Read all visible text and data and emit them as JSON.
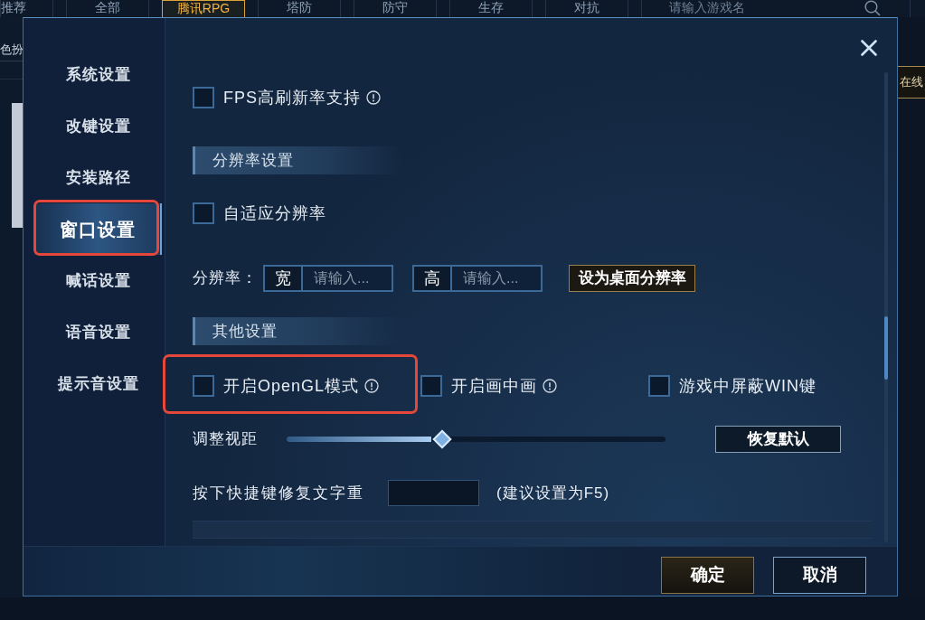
{
  "category_tabs": [
    {
      "label": "推荐",
      "selected": false
    },
    {
      "label": "全部",
      "selected": false
    },
    {
      "label": "腾讯RPG",
      "selected": true
    },
    {
      "label": "塔防",
      "selected": false
    },
    {
      "label": "防守",
      "selected": false
    },
    {
      "label": "生存",
      "selected": false
    },
    {
      "label": "对抗",
      "selected": false
    }
  ],
  "game_search": {
    "placeholder": "请输入游戏名"
  },
  "side_category": "色扮",
  "online_button": "在线",
  "settings_dialog": {
    "sidebar": [
      {
        "label": "系统设置",
        "selected": false,
        "highlighted": false
      },
      {
        "label": "改键设置",
        "selected": false,
        "highlighted": false
      },
      {
        "label": "安装路径",
        "selected": false,
        "highlighted": false
      },
      {
        "label": "窗口设置",
        "selected": true,
        "highlighted": true
      },
      {
        "label": "喊话设置",
        "selected": false,
        "highlighted": false
      },
      {
        "label": "语音设置",
        "selected": false,
        "highlighted": false
      },
      {
        "label": "提示音设置",
        "selected": false,
        "highlighted": false
      }
    ],
    "settings": [
      {
        "kind": "checkbox",
        "label": "FPS高刷新率支持",
        "checked": false,
        "info": true
      },
      {
        "kind": "section",
        "title": "分辨率设置"
      },
      {
        "kind": "checkbox",
        "label": "自适应分辨率",
        "checked": false,
        "info": false
      },
      {
        "kind": "resolution",
        "label": "分辨率：",
        "fields": [
          {
            "label": "宽",
            "placeholder": "请输入..."
          },
          {
            "label": "高",
            "placeholder": "请输入..."
          }
        ],
        "button": "设为桌面分辨率"
      },
      {
        "kind": "section",
        "title": "其他设置"
      },
      {
        "kind": "options",
        "options": [
          {
            "label": "开启OpenGL模式",
            "checked": false,
            "info": true,
            "highlighted": true
          },
          {
            "label": "开启画中画",
            "checked": false,
            "info": true,
            "highlighted": false
          },
          {
            "label": "游戏中屏蔽WIN键",
            "checked": false,
            "info": false,
            "highlighted": false
          }
        ]
      },
      {
        "kind": "slider",
        "label": "调整视距",
        "level": 0.41,
        "button": "恢复默认"
      },
      {
        "kind": "hotkey",
        "label": "按下快捷键修复文字重",
        "hint": "(建议设置为F5)"
      }
    ],
    "buttons": [
      {
        "label": "确定",
        "kind": "confirm"
      },
      {
        "label": "取消",
        "kind": "cancel"
      }
    ]
  }
}
